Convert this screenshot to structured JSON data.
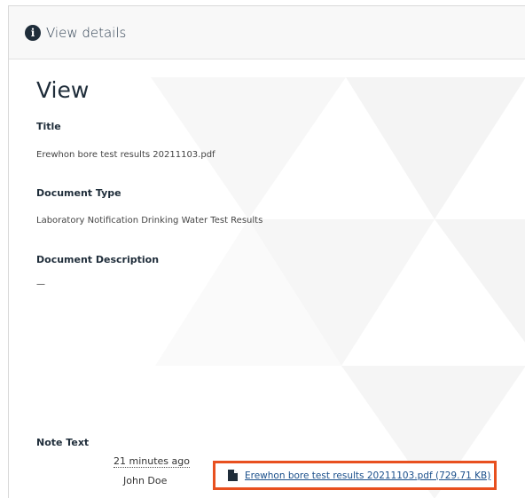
{
  "header": {
    "title": "View details",
    "icon": "info-icon"
  },
  "view": {
    "heading": "View",
    "fields": [
      {
        "label": "Title",
        "value": "Erewhon bore test results 20211103.pdf"
      },
      {
        "label": "Document Type",
        "value": "Laboratory Notification Drinking Water Test Results"
      },
      {
        "label": "Document Description",
        "value": "—"
      }
    ]
  },
  "note": {
    "label": "Note Text",
    "time": "21 minutes ago",
    "author": "John Doe",
    "attachment": {
      "text": "Erewhon bore test results 20211103.pdf (729.71 KB)",
      "icon": "file-icon"
    }
  },
  "colors": {
    "highlight": "#e8501f",
    "link": "#1a4f8b",
    "title": "#1f2d3a"
  }
}
